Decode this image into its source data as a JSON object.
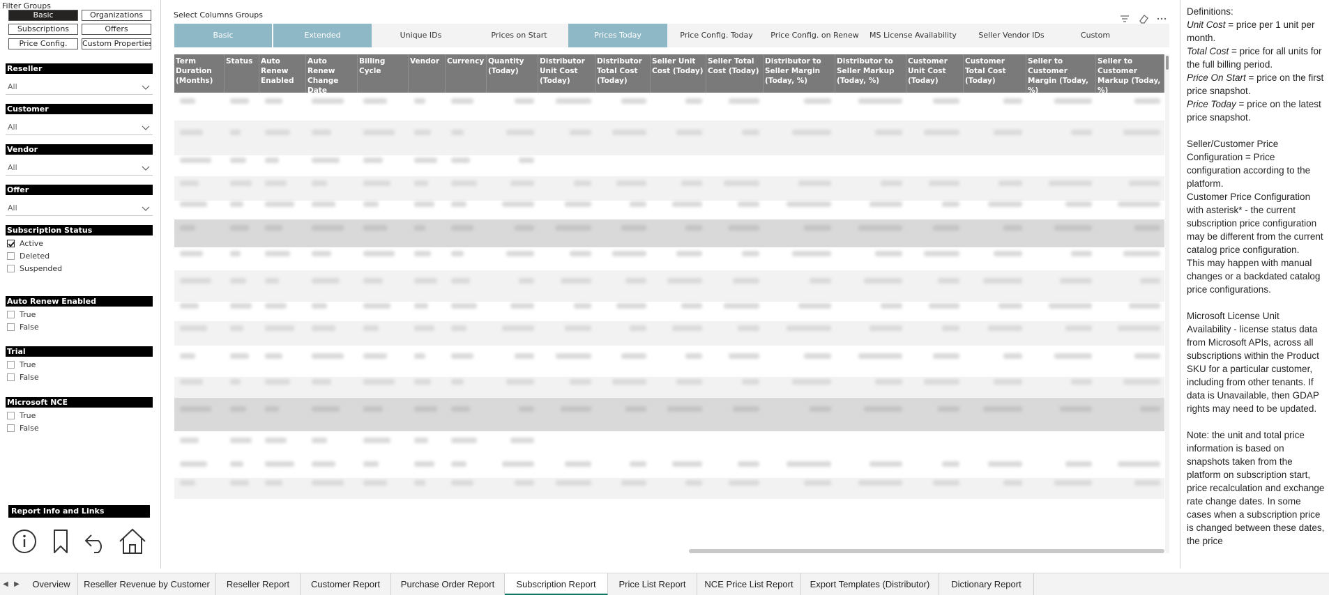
{
  "filter_groups": {
    "title": "Filter Groups",
    "buttons": [
      {
        "label": "Basic",
        "active": true
      },
      {
        "label": "Organizations",
        "active": false
      },
      {
        "label": "Subscriptions",
        "active": false
      },
      {
        "label": "Offers",
        "active": false
      },
      {
        "label": "Price Config.",
        "active": false
      },
      {
        "label": "Custom Properties",
        "active": false
      }
    ]
  },
  "slicers": {
    "reseller": {
      "title": "Reseller",
      "value": "All"
    },
    "customer": {
      "title": "Customer",
      "value": "All"
    },
    "vendor": {
      "title": "Vendor",
      "value": "All"
    },
    "offer": {
      "title": "Offer",
      "value": "All"
    },
    "subscription_status": {
      "title": "Subscription Status",
      "options": [
        {
          "label": "Active",
          "checked": true
        },
        {
          "label": "Deleted",
          "checked": false
        },
        {
          "label": "Suspended",
          "checked": false
        }
      ]
    },
    "auto_renew": {
      "title": "Auto Renew Enabled",
      "options": [
        {
          "label": "True",
          "checked": false
        },
        {
          "label": "False",
          "checked": false
        }
      ]
    },
    "trial": {
      "title": "Trial",
      "options": [
        {
          "label": "True",
          "checked": false
        },
        {
          "label": "False",
          "checked": false
        }
      ]
    },
    "microsoft_nce": {
      "title": "Microsoft NCE",
      "options": [
        {
          "label": "True",
          "checked": false
        },
        {
          "label": "False",
          "checked": false
        }
      ]
    }
  },
  "report_info": {
    "title": "Report Info and Links",
    "icons": [
      "info-icon",
      "bookmark-icon",
      "undo-icon",
      "home-icon"
    ]
  },
  "column_groups": {
    "title": "Select Columns Groups",
    "tabs": [
      {
        "label": "Basic",
        "active": true
      },
      {
        "label": "Extended",
        "active": true
      },
      {
        "label": "Unique IDs",
        "active": false
      },
      {
        "label": "Prices on Start",
        "active": false
      },
      {
        "label": "Prices Today",
        "active": true
      },
      {
        "label": "Price Config. Today",
        "active": false
      },
      {
        "label": "Price Config. on Renew",
        "active": false
      },
      {
        "label": "MS License Availability",
        "active": false
      },
      {
        "label": "Seller Vendor IDs",
        "active": false
      },
      {
        "label": "Custom",
        "active": false
      }
    ]
  },
  "table": {
    "columns": [
      "Term Duration (Months)",
      "Status",
      "Auto Renew Enabled",
      "Auto Renew Change Date",
      "Billing Cycle",
      "Vendor",
      "Currency",
      "Quantity (Today)",
      "Distributor Unit Cost (Today)",
      "Distributor Total Cost (Today)",
      "Seller Unit Cost (Today)",
      "Seller Total Cost (Today)",
      "Distributor to Seller Margin (Today, %)",
      "Distributor to Seller Markup (Today, %)",
      "Customer Unit Cost (Today)",
      "Customer Total Cost (Today)",
      "Seller to Customer Margin (Today, %)",
      "Seller to Customer Markup (Today, %)"
    ]
  },
  "definitions": {
    "title": "Definitions:",
    "unit_cost_term": "Unit Cost",
    "unit_cost_def": " = price per 1 unit per month.",
    "total_cost_term": "Total Cost",
    "total_cost_def": " = price for all units for the full billing period.",
    "price_on_start_term": "Price On Start",
    "price_on_start_def": " = price on the first price snapshot.",
    "price_today_term": "Price Today",
    "price_today_def": " = price on the latest price snapshot.",
    "price_config_para": "Seller/Customer Price Configuration = Price configuration according to the platform.",
    "asterisk_para_1": "Customer Price Configuration with asterisk* - the current subscription price configuration may be different from the current catalog price configuration.",
    "asterisk_para_2": "This may happen with manual changes or a backdated catalog price configurations.",
    "ms_license_para": "Microsoft License Unit Availability - license status data from Microsoft APIs, across all subscriptions within the Product SKU for a particular customer, including from other tenants. If data is Unavailable, then GDAP rights may need to be updated.",
    "note_para": "Note: the unit and total price information is based on snapshots taken from the platform on subscription start, price recalculation and exchange rate change dates. In some cases when a subscription price is changed between these dates, the price"
  },
  "page_tabs": [
    {
      "label": "Overview",
      "active": false
    },
    {
      "label": "Reseller Revenue by Customer",
      "active": false
    },
    {
      "label": "Reseller Report",
      "active": false
    },
    {
      "label": "Customer Report",
      "active": false
    },
    {
      "label": "Purchase Order Report",
      "active": false
    },
    {
      "label": "Subscription Report",
      "active": true
    },
    {
      "label": "Price List Report",
      "active": false
    },
    {
      "label": "NCE Price List Report",
      "active": false
    },
    {
      "label": "Export Templates (Distributor)",
      "active": false
    },
    {
      "label": "Dictionary Report",
      "active": false
    }
  ],
  "colors": {
    "accent_tab": "#8fb8c7",
    "header_bg": "#7a7a7a",
    "active_page_underline": "#117865"
  }
}
